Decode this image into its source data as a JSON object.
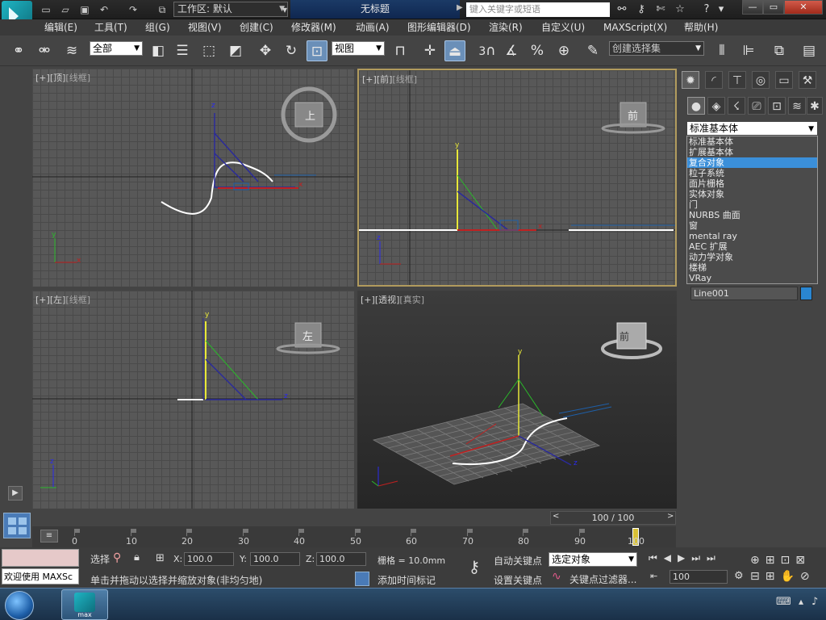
{
  "titlebar": {
    "workspace": "工作区: 默认",
    "doc_title": "无标题",
    "search_placeholder": "键入关键字或短语"
  },
  "menu": [
    "编辑(E)",
    "工具(T)",
    "组(G)",
    "视图(V)",
    "创建(C)",
    "修改器(M)",
    "动画(A)",
    "图形编辑器(D)",
    "渲染(R)",
    "自定义(U)",
    "MAXScript(X)",
    "帮助(H)"
  ],
  "toolbar": {
    "filter": "全部",
    "ref_coord": "视图",
    "selection_set": "创建选择集",
    "snap_num": "3",
    "percent": "%"
  },
  "viewports": {
    "top": {
      "plus": "[+]",
      "name": "[顶]",
      "mode": "[线框]",
      "cube": "上"
    },
    "front": {
      "plus": "[+]",
      "name": "[前]",
      "mode": "[线框]",
      "cube": "前"
    },
    "left": {
      "plus": "[+]",
      "name": "[左]",
      "mode": "[线框]",
      "cube": "左"
    },
    "persp": {
      "plus": "[+]",
      "name": "[透视]",
      "mode": "[真实]",
      "cube": "前"
    }
  },
  "axis": {
    "x": "x",
    "y": "y",
    "z": "z"
  },
  "command_panel": {
    "category": "标准基本体",
    "options": [
      "标准基本体",
      "扩展基本体",
      "复合对象",
      "粒子系统",
      "面片栅格",
      "实体对象",
      "门",
      "NURBS 曲面",
      "窗",
      "mental ray",
      "AEC 扩展",
      "动力学对象",
      "楼梯",
      "VRay"
    ],
    "selected_index": 2,
    "object_name": "Line001",
    "object_color": "#2a86d1"
  },
  "timeline": {
    "frame_display": "100 / 100",
    "ticks": [
      "0",
      "10",
      "20",
      "30",
      "40",
      "50",
      "60",
      "70",
      "80",
      "90",
      "100"
    ],
    "current_frame": 100
  },
  "status": {
    "maxscript_label": "欢迎使用 MAXSc",
    "selection_prefix": "选择",
    "x_label": "X:",
    "x_value": "100.0",
    "y_label": "Y:",
    "y_value": "100.0",
    "z_label": "Z:",
    "z_value": "100.0",
    "grid": "栅格 = 10.0mm",
    "prompt": "单击并拖动以选择并缩放对象(非均匀地)",
    "add_time_tag": "添加时间标记",
    "auto_key": "自动关键点",
    "set_key": "设置关键点",
    "key_mode": "选定对象",
    "key_filters": "关键点过滤器...",
    "frame_field": "100"
  },
  "taskbar": {
    "app_label": "max"
  }
}
